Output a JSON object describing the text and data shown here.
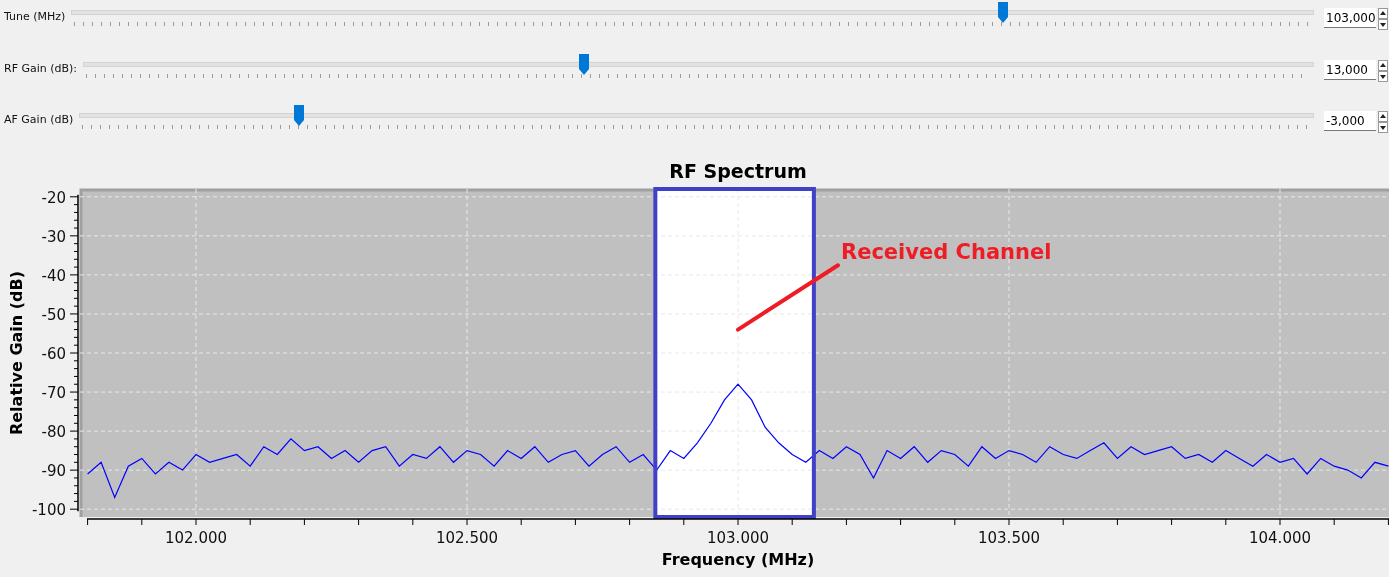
{
  "sliders": [
    {
      "label": "Tune (MHz)",
      "level": 0.75,
      "value": "103,000"
    },
    {
      "label": "RF Gain (dB):",
      "level": 0.407,
      "value": "13,000"
    },
    {
      "label": "AF Gain (dB)",
      "level": 0.178,
      "value": "-3,000"
    }
  ],
  "spectrum": {
    "chart_data": {
      "type": "line",
      "title": "RF Spectrum",
      "xlabel": "Frequency (MHz)",
      "ylabel": "Relative Gain (dB)",
      "categories": [
        null,
        null,
        null,
        null,
        null,
        null,
        null,
        null,
        "102.000",
        null,
        null,
        null,
        null,
        null,
        null,
        null,
        null,
        null,
        null,
        null,
        null,
        null,
        null,
        null,
        null,
        null,
        null,
        null,
        "102.500",
        null,
        null,
        null,
        null,
        null,
        null,
        null,
        null,
        null,
        null,
        null,
        null,
        null,
        null,
        null,
        null,
        null,
        null,
        null,
        "103.000",
        null,
        null,
        null,
        null,
        null,
        null,
        null,
        null,
        null,
        null,
        null,
        null,
        null,
        null,
        null,
        null,
        null,
        null,
        null,
        "103.500",
        null,
        null,
        null,
        null,
        null,
        null,
        null,
        null,
        null,
        null,
        null,
        null,
        null,
        null,
        null,
        null,
        null,
        null,
        null,
        "104.000",
        null,
        null,
        null,
        null,
        null,
        null,
        null,
        null
      ],
      "series": [
        {
          "color": "#0000ff",
          "values": [
            -91,
            -88,
            -97,
            -89,
            -87,
            -91,
            -88,
            -90,
            -86,
            -88,
            -87,
            -86,
            -89,
            -84,
            -86,
            -82,
            -85,
            -84,
            -87,
            -85,
            -88,
            -85,
            -84,
            -89,
            -86,
            -87,
            -84,
            -88,
            -85,
            -86,
            -89,
            -85,
            -87,
            -84,
            -88,
            -86,
            -85,
            -89,
            -86,
            -84,
            -88,
            -86,
            -90,
            -85,
            -87,
            -83,
            -78,
            -72,
            -68,
            -72,
            -79,
            -83,
            -86,
            -88,
            -85,
            -87,
            -84,
            -86,
            -92,
            -85,
            -87,
            -84,
            -88,
            -85,
            -86,
            -89,
            -84,
            -87,
            -85,
            -86,
            -88,
            -84,
            -86,
            -87,
            -85,
            -83,
            -87,
            -84,
            -86,
            -85,
            -84,
            -87,
            -86,
            -88,
            -85,
            -87,
            -89,
            -86,
            -88,
            -87,
            -91,
            -87,
            -89,
            -90,
            -92,
            -88,
            -89
          ]
        }
      ],
      "ylim": [
        -102,
        -18
      ],
      "yticks": [
        -20,
        -30,
        -40,
        -50,
        -60,
        -70,
        -80,
        -90,
        -100
      ],
      "annotations": [
        "Received Channel"
      ],
      "grid": true
    },
    "highlight_box": true
  }
}
